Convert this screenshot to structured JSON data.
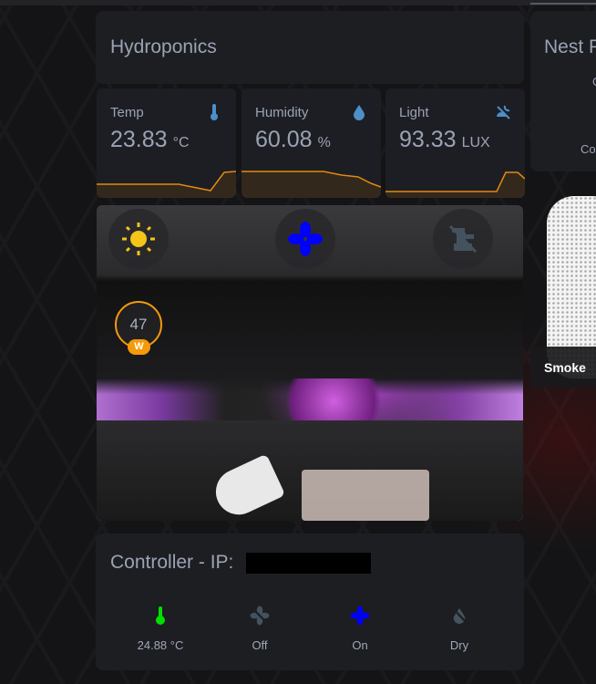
{
  "hydroponics": {
    "title": "Hydroponics",
    "sensors": [
      {
        "label": "Temp",
        "value": "23.83",
        "unit": "°C",
        "icon": "thermometer-icon"
      },
      {
        "label": "Humidity",
        "value": "60.08",
        "unit": "%",
        "icon": "water-percent-icon"
      },
      {
        "label": "Light",
        "value": "93.33",
        "unit": "LUX",
        "icon": "weather-night-partly-cloudy-icon"
      }
    ],
    "camera": {
      "buttons": [
        "sun-icon",
        "fan-icon",
        "water-pump-off-icon"
      ],
      "gauge_value": "47",
      "gauge_badge": "W"
    }
  },
  "controller": {
    "title": "Controller - IP:",
    "items": [
      {
        "label": "24.88 °C",
        "icon": "thermometer-icon",
        "color": "#00e000"
      },
      {
        "label": "Off",
        "icon": "fan-off-icon",
        "color": "#44525e"
      },
      {
        "label": "On",
        "icon": "fan-icon",
        "color": "#0000ff"
      },
      {
        "label": "Dry",
        "icon": "water-off-icon",
        "color": "#44525e"
      }
    ]
  },
  "nest": {
    "title": "Nest P",
    "line1": "C",
    "line2": "Co",
    "smoke_label": "Smoke"
  },
  "colors": {
    "accent": "#f59a0b",
    "graph": "#e08a10",
    "icon_blue": "#4d8fc9"
  }
}
